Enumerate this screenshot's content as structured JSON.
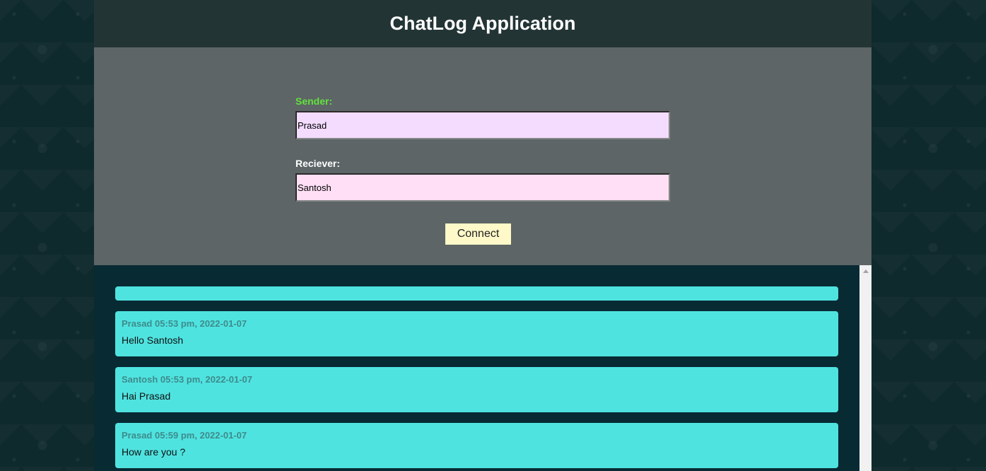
{
  "app": {
    "title": "ChatLog Application"
  },
  "form": {
    "sender_label": "Sender:",
    "sender_value": "Prasad",
    "receiver_label": "Reciever:",
    "receiver_value": "Santosh",
    "connect_label": "Connect"
  },
  "messages": [
    {
      "sender": "Prasad",
      "time": "05:53 pm, 2022-01-07",
      "text": "Hello Santosh"
    },
    {
      "sender": "Santosh",
      "time": "05:53 pm, 2022-01-07",
      "text": "Hai Prasad"
    },
    {
      "sender": "Prasad",
      "time": "05:59 pm, 2022-01-07",
      "text": "How are you ?"
    }
  ],
  "colors": {
    "header_bg": "#233435",
    "form_bg": "#5d6566",
    "sender_label": "#62e23d",
    "message_card": "#4fe3e0",
    "messages_bg": "#082a33",
    "connect_button": "#fff8c8"
  }
}
